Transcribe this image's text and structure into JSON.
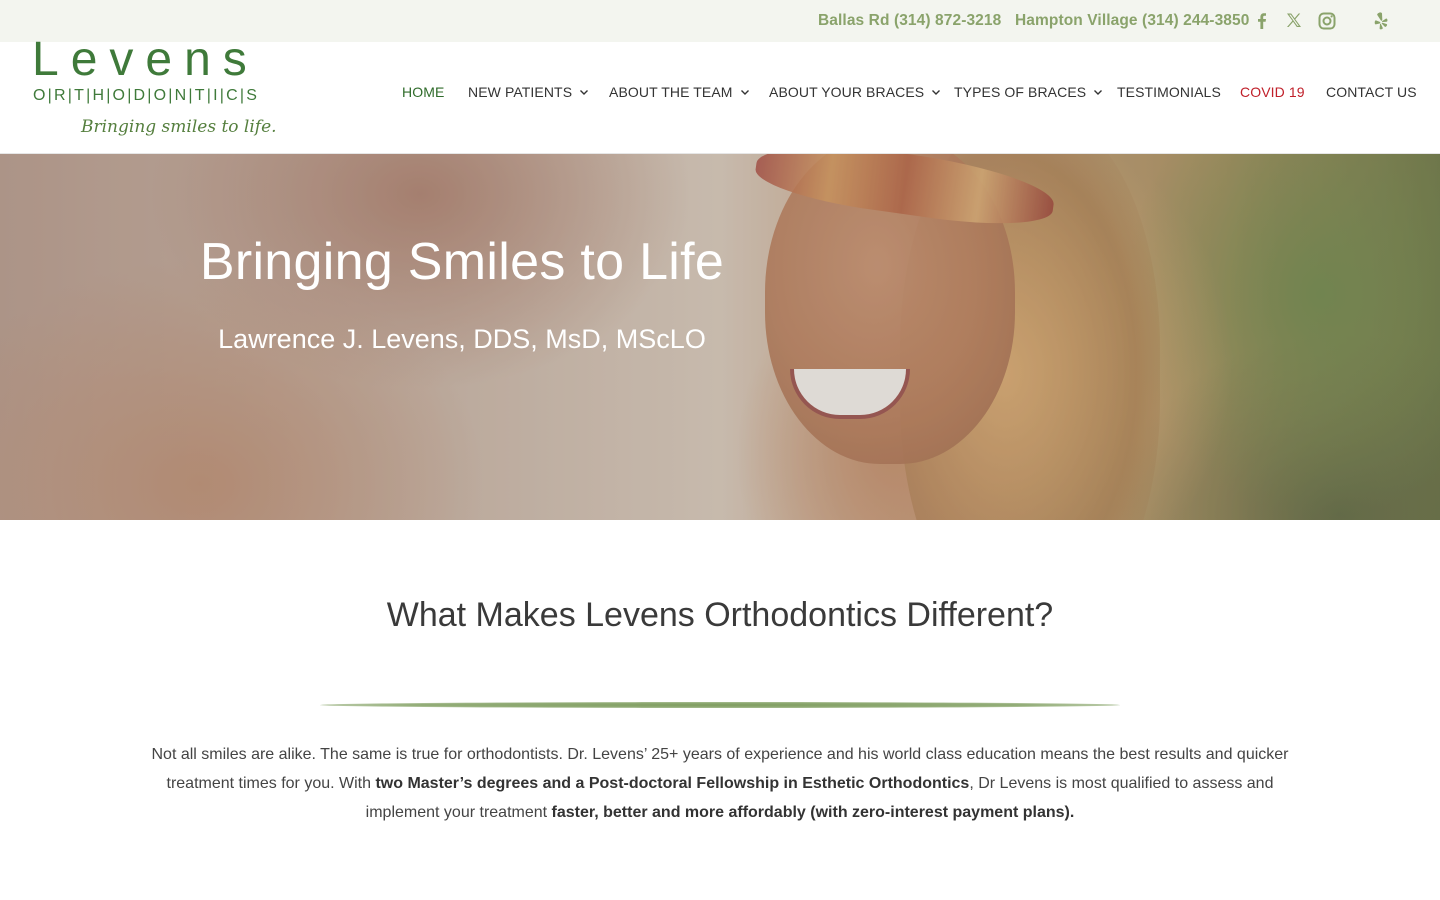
{
  "topbar": {
    "phone_ballas": "Ballas Rd (314) 872-3218",
    "phone_hampton": "Hampton Village (314) 244-3850",
    "social_icons": [
      "facebook-icon",
      "x-twitter-icon",
      "instagram-icon",
      "yelp-icon"
    ],
    "icon_color": "#8aa36b"
  },
  "logo": {
    "wordmark": "Levens",
    "sub": "O|R|T|H|O|D|O|N|T|I|C|S",
    "tagline": "Bringing smiles to life."
  },
  "nav": {
    "items": [
      {
        "label": "HOME",
        "dropdown": false
      },
      {
        "label": "NEW PATIENTS",
        "dropdown": true
      },
      {
        "label": "ABOUT THE TEAM",
        "dropdown": true
      },
      {
        "label": "ABOUT YOUR BRACES",
        "dropdown": true
      },
      {
        "label": "TYPES OF BRACES",
        "dropdown": true
      },
      {
        "label": "TESTIMONIALS",
        "dropdown": false
      },
      {
        "label": "COVID 19",
        "dropdown": false
      },
      {
        "label": "CONTACT US",
        "dropdown": false
      }
    ],
    "active_color": "#2f6b2a",
    "alert_color": "#c0202a"
  },
  "hero": {
    "title": "Bringing Smiles to Life",
    "subtitle": "Lawrence J. Levens, DDS, MsD, MScLO"
  },
  "content": {
    "heading": "What Makes Levens Orthodontics Different?",
    "p1": "Not all smiles are alike. The same is true for orthodontists. Dr. Levens’ 25+ years of experience and his world class education means the best results and quicker treatment times for you. With ",
    "b1": "two Master’s degrees and a Post-doctoral Fellowship in Esthetic Orthodontics",
    "p2": ", Dr Levens is most qualified to assess and implement your treatment ",
    "b2": "faster, better and more affordably (with zero-interest payment plans)."
  }
}
